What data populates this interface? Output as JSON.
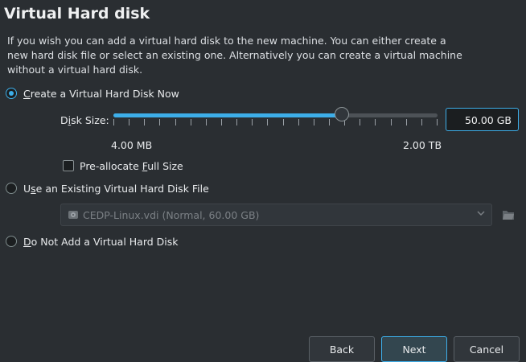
{
  "page": {
    "title": "Virtual Hard disk",
    "description": "If you wish you can add a virtual hard disk to the new machine. You can either create a new hard disk file or select an existing one. Alternatively you can create a virtual machine without a virtual hard disk."
  },
  "options": {
    "create_now": {
      "prefix": "",
      "mnemonic": "C",
      "rest": "reate a Virtual Hard Disk Now",
      "selected": true
    },
    "use_existing": {
      "prefix": "U",
      "mnemonic": "s",
      "rest": "e an Existing Virtual Hard Disk File",
      "selected": false
    },
    "do_not_add": {
      "prefix": "",
      "mnemonic": "D",
      "rest": "o Not Add a Virtual Hard Disk",
      "selected": false
    }
  },
  "disk_size": {
    "label_prefix": "D",
    "label_mnemonic": "i",
    "label_rest": "sk Size:",
    "value": "50.00 GB",
    "min_label": "4.00 MB",
    "max_label": "2.00 TB",
    "slider_fraction": 0.705
  },
  "preallocate": {
    "prefix": "Pre-allocate ",
    "mnemonic": "F",
    "rest": "ull Size",
    "checked": false
  },
  "existing_file": {
    "value": "CEDP-Linux.vdi (Normal, 60.00 GB)"
  },
  "buttons": {
    "back": "Back",
    "next": "Next",
    "cancel": "Cancel"
  },
  "colors": {
    "accent": "#3daee9",
    "background": "#2a2e32"
  },
  "icons": [
    "hard-disk-icon",
    "chevron-down-icon",
    "folder-icon"
  ]
}
